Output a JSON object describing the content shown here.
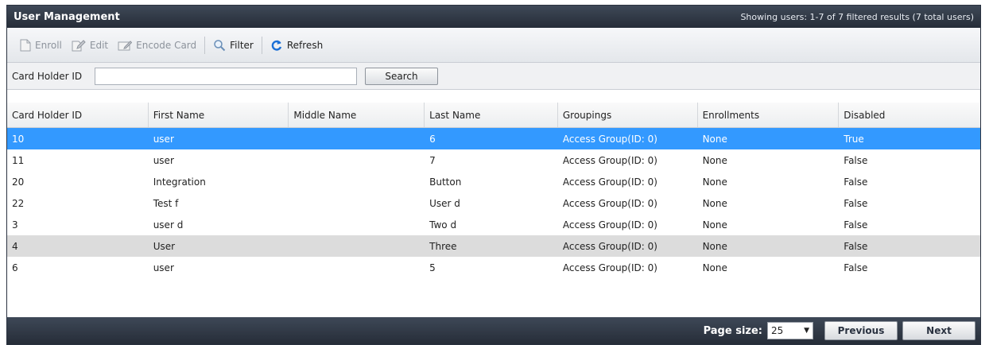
{
  "window": {
    "title": "User Management",
    "summary": "Showing users: 1-7 of 7 filtered results (7 total users)"
  },
  "toolbar": {
    "enroll": "Enroll",
    "edit": "Edit",
    "encode_card": "Encode Card",
    "filter": "Filter",
    "refresh": "Refresh"
  },
  "search": {
    "label": "Card Holder ID",
    "value": "",
    "button": "Search"
  },
  "table": {
    "columns": [
      "Card Holder ID",
      "First Name",
      "Middle Name",
      "Last Name",
      "Groupings",
      "Enrollments",
      "Disabled"
    ],
    "rows": [
      [
        "10",
        "user",
        "",
        "6",
        "Access Group(ID: 0)",
        "None",
        "True"
      ],
      [
        "11",
        "user",
        "",
        "7",
        "Access Group(ID: 0)",
        "None",
        "False"
      ],
      [
        "20",
        "Integration",
        "",
        "Button",
        "Access Group(ID: 0)",
        "None",
        "False"
      ],
      [
        "22",
        "Test f",
        "",
        "User d",
        "Access Group(ID: 0)",
        "None",
        "False"
      ],
      [
        "3",
        "user d",
        "",
        "Two d",
        "Access Group(ID: 0)",
        "None",
        "False"
      ],
      [
        "4",
        "User",
        "",
        "Three",
        "Access Group(ID: 0)",
        "None",
        "False"
      ],
      [
        "6",
        "user",
        "",
        "5",
        "Access Group(ID: 0)",
        "None",
        "False"
      ]
    ]
  },
  "footer": {
    "page_size_label": "Page size:",
    "page_size_value": "25",
    "previous": "Previous",
    "next": "Next"
  },
  "colors": {
    "selection": "#3399ff",
    "highlight_row": "#dcdcdc",
    "chrome_dark": "#2a3240",
    "refresh_icon": "#1a6fd6"
  },
  "icons": {
    "enroll": "document-icon",
    "edit": "edit-document-icon",
    "encode_card": "card-icon",
    "filter": "magnifier-icon",
    "refresh": "refresh-icon"
  }
}
